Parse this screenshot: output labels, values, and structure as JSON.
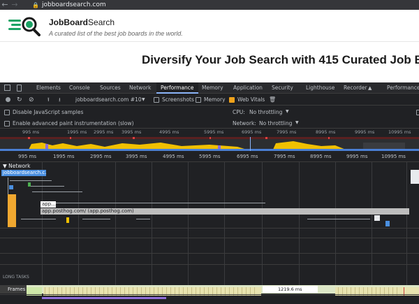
{
  "browser": {
    "url": "jobboardsearch.com"
  },
  "site": {
    "brand_name": "JobBoard",
    "brand_suffix": "Search",
    "tagline": "A curated list of the best job boards in the world.",
    "headline": "Diversify Your Job Search with 415 Curated Job B",
    "brand_color": "#1aa364"
  },
  "devtools": {
    "tabs": [
      "Elements",
      "Console",
      "Sources",
      "Network",
      "Performance",
      "Memory",
      "Application",
      "Security",
      "Lighthouse",
      "Recorder",
      "Performance"
    ],
    "active_tab": "Performance",
    "toolbar": {
      "recording": "jobboardsearch.com #10",
      "screenshots": "Screenshots",
      "memory": "Memory",
      "web_vitals": "Web Vitals"
    },
    "settings": {
      "disable_js": "Disable JavaScript samples",
      "paint": "Enable advanced paint instrumentation (slow)",
      "cpu_label": "CPU:",
      "cpu_value": "No throttling",
      "network_label": "Network:",
      "network_value": "No throttling"
    },
    "overview_ticks": [
      "995 ms",
      "1995 ms",
      "2995 ms",
      "3995 ms",
      "4995 ms",
      "5995 ms",
      "6995 ms",
      "7995 ms",
      "8995 ms",
      "9995 ms",
      "10995 ms"
    ],
    "ruler_ticks": [
      "995 ms",
      "1995 ms",
      "2995 ms",
      "3995 ms",
      "4995 ms",
      "5995 ms",
      "6995 ms",
      "7995 ms",
      "8995 ms",
      "9995 ms",
      "10995 ms"
    ],
    "network_label": "Network",
    "requests": {
      "main": "jobboardsearch.c...",
      "app_short": "app...",
      "app_long": "app.posthog.com/ (app.posthog.com)"
    },
    "long_tasks": "LONG TASKS",
    "frames": "Frames",
    "frame_duration": "1219.6 ms"
  }
}
